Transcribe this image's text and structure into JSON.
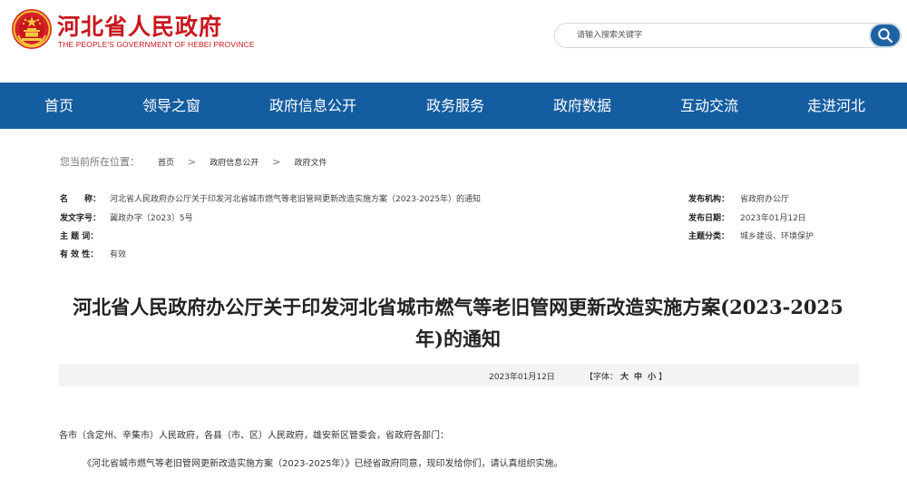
{
  "header": {
    "logo_cn": "河北省人民政府",
    "logo_en": "THE PEOPLE'S GOVERNMENT OF HEBEI PROVINCE",
    "search_placeholder": "请输入搜索关键字"
  },
  "nav": [
    "首页",
    "领导之窗",
    "政府信息公开",
    "政务服务",
    "政府数据",
    "互动交流",
    "走进河北"
  ],
  "breadcrumb": {
    "label": "您当前所在位置：",
    "items": [
      "首页",
      "政府信息公开",
      "政府文件"
    ],
    "sep": ">"
  },
  "meta": {
    "name_key": "名　　称：",
    "name_val": "河北省人民政府办公厅关于印发河北省城市燃气等老旧管网更新改造实施方案（2023-2025年）的通知",
    "docno_key": "发文字号：",
    "docno_val": "冀政办字〔2023〕5号",
    "subject_key": "主 题 词：",
    "subject_val": "",
    "valid_key": "有 效 性：",
    "valid_val": "有效",
    "org_key": "发布机构：",
    "org_val": "省政府办公厅",
    "date_key": "发布日期：",
    "date_val": "2023年01月12日",
    "category_key": "主题分类：",
    "category_val": "城乡建设、环境保护"
  },
  "title_line1": "河北省人民政府办公厅关于印发河北省城市燃气等老旧管网更新改造实施方案(2023-2025",
  "title_line2": "年)的通知",
  "infobar": {
    "date": "2023年01月12日",
    "font_prefix": "【字体：",
    "big": "大",
    "mid": "中",
    "small": "小",
    "font_suffix": "】"
  },
  "body": {
    "para1": "各市（含定州、辛集市）人民政府，各县（市、区）人民政府，雄安新区管委会，省政府各部门：",
    "para2": "《河北省城市燃气等老旧管网更新改造实施方案（2023-2025年）》已经省政府同意，现印发给你们，请认真组织实施。"
  },
  "colors": {
    "brand_red": "#c8161d",
    "nav_blue": "#145da0"
  }
}
